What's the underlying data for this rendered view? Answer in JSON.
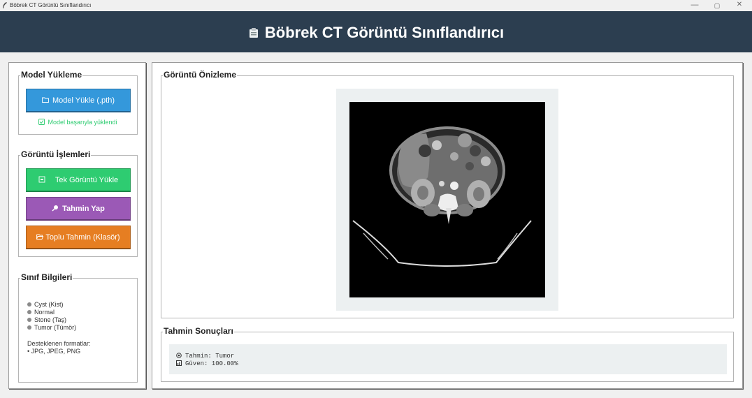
{
  "window": {
    "title": "Böbrek CT Görüntü Sınıflandırıcı",
    "minimize": "—",
    "restore": "▢",
    "close": "✕"
  },
  "header": {
    "title": "Böbrek CT Görüntü Sınıflandırıcı",
    "icon": "clipboard-icon",
    "bg_color": "#2c3e50"
  },
  "model_section": {
    "legend": "Model Yükleme",
    "load_button": "Model Yükle (.pth)",
    "load_icon": "folder-icon",
    "status": "Model başarıyla yüklendi",
    "status_icon": "checkbox-icon",
    "status_color": "#2ecc71"
  },
  "image_section": {
    "legend": "Görüntü İşlemleri",
    "single_button": "Tek Görüntü Yükle",
    "predict_button": "Tahmin Yap",
    "batch_button": "Toplu Tahmin (Klasör)",
    "colors": {
      "single": "#2ecc71",
      "predict": "#9b59b6",
      "batch": "#e67e22",
      "load_model": "#3498db"
    }
  },
  "class_section": {
    "legend": "Sınıf Bilgileri",
    "classes": [
      "Cyst (Kist)",
      "Normal",
      "Stone (Taş)",
      "Tumor (Tümör)"
    ],
    "formats_label": "Desteklenen formatlar:",
    "formats_value": "• JPG, JPEG, PNG"
  },
  "preview": {
    "legend": "Görüntü Önizleme",
    "image": "kidney-ct-scan"
  },
  "results": {
    "legend": "Tahmin Sonuçları",
    "prediction": "Tahmin: Tumor",
    "confidence": "Güven: 100.00%",
    "prediction_icon": "target-icon",
    "confidence_icon": "chart-icon"
  }
}
